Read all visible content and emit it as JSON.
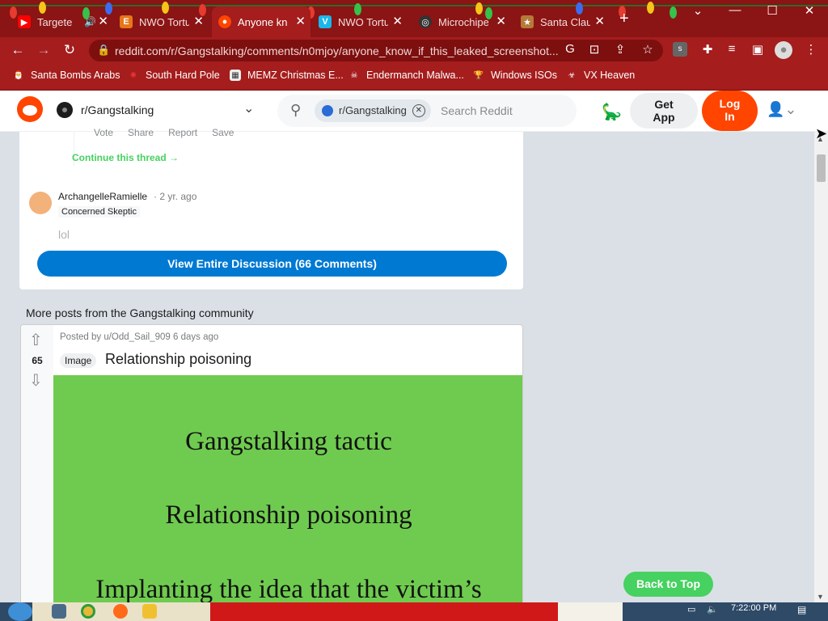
{
  "browser": {
    "tabs": [
      {
        "title": "Targete",
        "icon": "youtube-icon",
        "color": "#ff0000",
        "active": false
      },
      {
        "title": "NWO Tortu",
        "icon": "e-site-icon",
        "color": "#e8761a",
        "active": false
      },
      {
        "title": "Anyone kn",
        "icon": "reddit-icon",
        "color": "#ff4500",
        "active": true
      },
      {
        "title": "NWO Tortu",
        "icon": "vimeo-icon",
        "color": "#1ab7ea",
        "active": false
      },
      {
        "title": "Microchipe",
        "icon": "site-icon",
        "color": "#333333",
        "active": false
      },
      {
        "title": "Santa Clau",
        "icon": "site-icon",
        "color": "#b57a3a",
        "active": false
      }
    ],
    "new_tab_label": "+",
    "url": "reddit.com/r/Gangstalking/comments/n0mjoy/anyone_know_if_this_leaked_screenshot...",
    "bookmarks": [
      {
        "label": "Santa Bombs Arabs",
        "icon": "santa-icon"
      },
      {
        "label": "South Hard Pole",
        "icon": "ornament-icon"
      },
      {
        "label": "MEMZ Christmas E...",
        "icon": "image-icon"
      },
      {
        "label": "Endermanch Malwa...",
        "icon": "skull-icon"
      },
      {
        "label": "Windows ISOs",
        "icon": "trophy-icon"
      },
      {
        "label": "VX Heaven",
        "icon": "biohazard-icon"
      }
    ]
  },
  "header": {
    "community": "r/Gangstalking",
    "search_chip": "r/Gangstalking",
    "search_placeholder": "Search Reddit",
    "get_app_line1": "Get",
    "get_app_line2": "App",
    "login_line1": "Log",
    "login_line2": "In"
  },
  "comment_card": {
    "vote_row": [
      "Vote",
      "Share",
      "Report",
      "Save"
    ],
    "continue_thread": "Continue this thread →",
    "author": "ArchangelleRamielle",
    "age": "· 2 yr. ago",
    "flair": "Concerned Skeptic",
    "body": "lol",
    "view_all_button": "View Entire Discussion (66 Comments)"
  },
  "more_posts": {
    "heading": "More posts from the Gangstalking community",
    "post": {
      "score": "65",
      "posted_by": "Posted by u/Odd_Sail_909 6 days ago",
      "tag": "Image",
      "title": "Relationship poisoning",
      "image_lines": [
        "Gangstalking tactic",
        "Relationship poisoning",
        "Implanting the idea that the victim’s"
      ]
    }
  },
  "back_to_top": "Back to Top",
  "taskbar": {
    "clock": "7:22:00 PM"
  },
  "colors": {
    "chrome_dark": "#8b1414",
    "chrome": "#a51d1d",
    "reddit_orange": "#ff4500",
    "blue_button": "#0079d3",
    "green": "#46d160",
    "post_image_bg": "#6fcb4f"
  }
}
